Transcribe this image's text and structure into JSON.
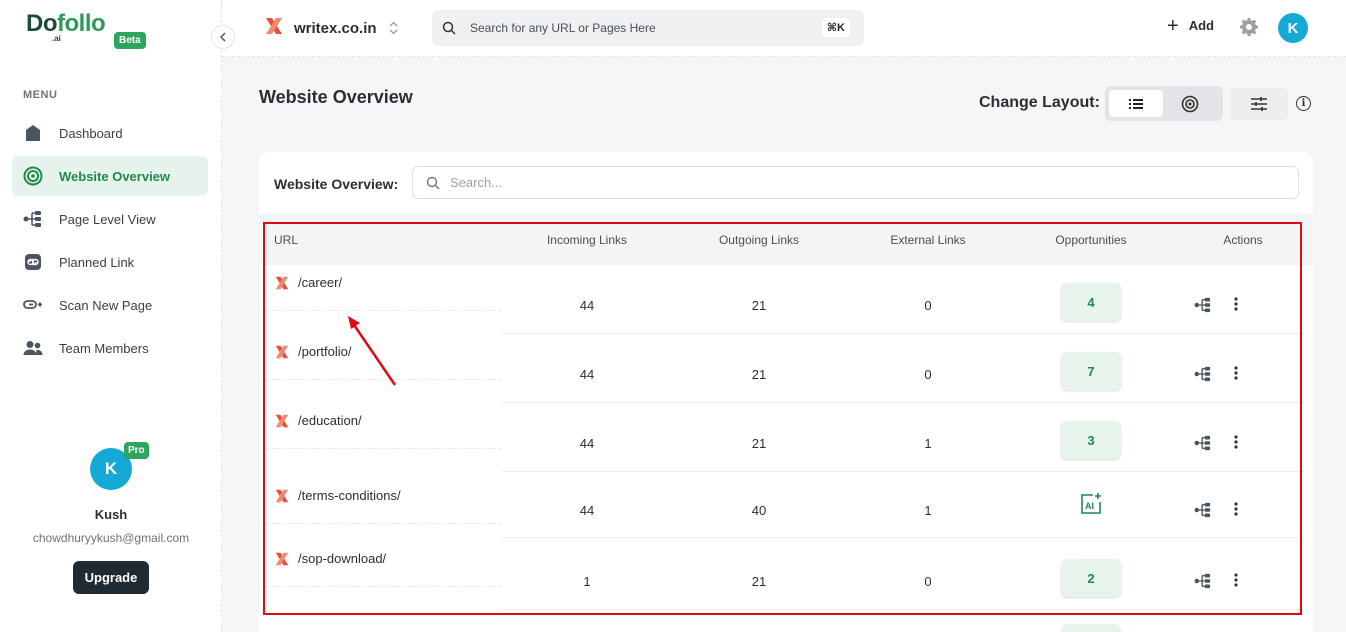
{
  "brand": {
    "logo_text": "Dofollo",
    "logo_ai": ".ai",
    "badge": "Beta"
  },
  "sidebar": {
    "menu_label": "MENU",
    "items": [
      {
        "label": "Dashboard",
        "icon": "home-icon",
        "active": false
      },
      {
        "label": "Website Overview",
        "icon": "target-icon",
        "active": true
      },
      {
        "label": "Page Level View",
        "icon": "tree-icon",
        "active": false
      },
      {
        "label": "Planned Link",
        "icon": "link-icon",
        "active": false
      },
      {
        "label": "Scan New Page",
        "icon": "scan-link-icon",
        "active": false
      },
      {
        "label": "Team Members",
        "icon": "users-icon",
        "active": false
      }
    ],
    "profile": {
      "initial": "K",
      "badge": "Pro",
      "name": "Kush",
      "email": "chowdhuryykush@gmail.com",
      "upgrade_label": "Upgrade"
    }
  },
  "topbar": {
    "site_name": "writex.co.in",
    "search_placeholder": "Search for any URL or Pages Here",
    "shortcut": "⌘K",
    "add_label": "Add",
    "avatar_initial": "K"
  },
  "main": {
    "title": "Website Overview",
    "change_layout_label": "Change Layout:",
    "card_label": "Website Overview:",
    "search_placeholder": "Search...",
    "columns": [
      "URL",
      "Incoming Links",
      "Outgoing Links",
      "External Links",
      "Opportunities",
      "Actions"
    ],
    "rows": [
      {
        "url": "/career/",
        "incoming": "44",
        "outgoing": "21",
        "external": "0",
        "opportunities": "4"
      },
      {
        "url": "/portfolio/",
        "incoming": "44",
        "outgoing": "21",
        "external": "0",
        "opportunities": "7"
      },
      {
        "url": "/education/",
        "incoming": "44",
        "outgoing": "21",
        "external": "1",
        "opportunities": "3"
      },
      {
        "url": "/terms-conditions/",
        "incoming": "44",
        "outgoing": "40",
        "external": "1",
        "opportunities": "AI"
      },
      {
        "url": "/sop-download/",
        "incoming": "1",
        "outgoing": "21",
        "external": "0",
        "opportunities": "2"
      }
    ]
  },
  "colors": {
    "accent": "#1f8a4c",
    "highlight_box": "#e30613",
    "avatar": "#15a9d6",
    "site_logo": "#e8503a"
  }
}
